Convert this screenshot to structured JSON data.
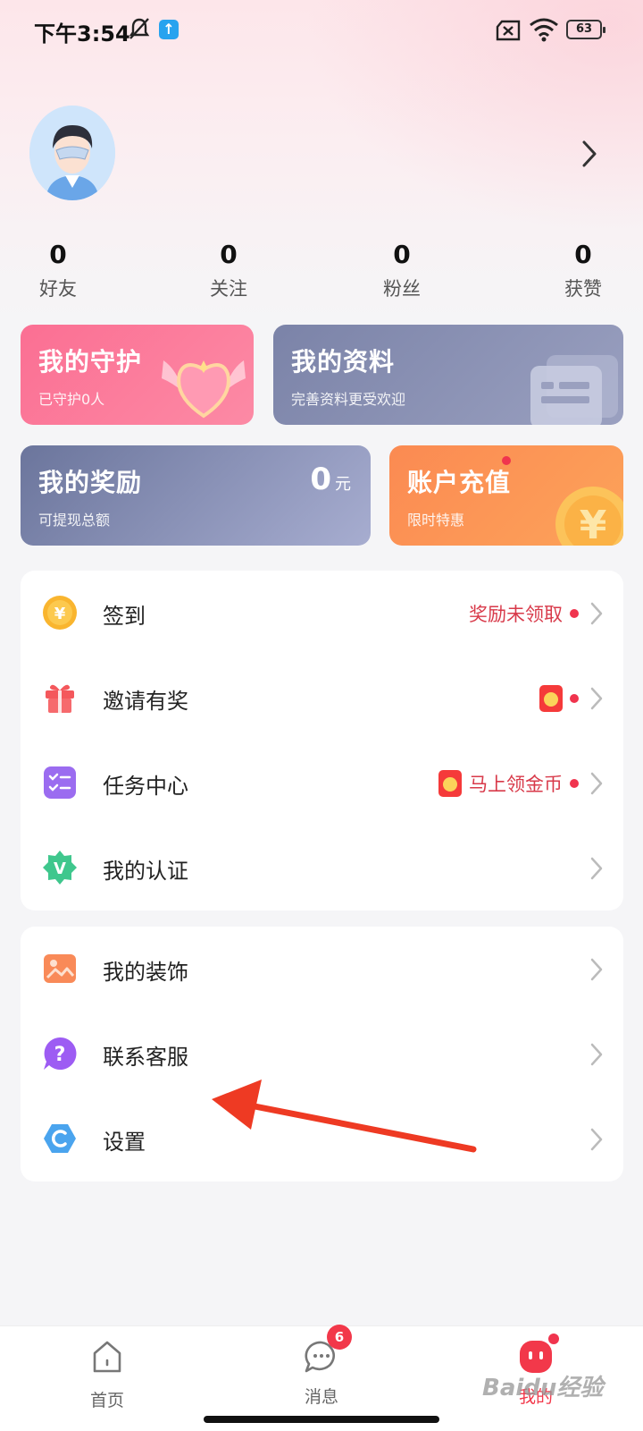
{
  "status_bar": {
    "time": "下午3:54",
    "battery": "63"
  },
  "stats": [
    {
      "value": "0",
      "label": "好友"
    },
    {
      "value": "0",
      "label": "关注"
    },
    {
      "value": "0",
      "label": "粉丝"
    },
    {
      "value": "0",
      "label": "获赞"
    }
  ],
  "cards": {
    "guard": {
      "title": "我的守护",
      "subtitle": "已守护0人"
    },
    "profile": {
      "title": "我的资料",
      "subtitle": "完善资料更受欢迎"
    },
    "reward": {
      "title": "我的奖励",
      "subtitle": "可提现总额",
      "amount": "0",
      "unit": "元"
    },
    "recharge": {
      "title": "账户充值",
      "subtitle": "限时特惠"
    }
  },
  "menu_group_1": [
    {
      "label": "签到",
      "right_text": "奖励未领取",
      "icon": "yen-coin-icon"
    },
    {
      "label": "邀请有奖",
      "right_text": "",
      "icon": "gift-icon"
    },
    {
      "label": "任务中心",
      "right_text": "马上领金币",
      "icon": "task-list-icon"
    },
    {
      "label": "我的认证",
      "right_text": "",
      "icon": "verified-badge-icon"
    }
  ],
  "menu_group_2": [
    {
      "label": "我的装饰",
      "icon": "picture-icon"
    },
    {
      "label": "联系客服",
      "icon": "help-question-icon"
    },
    {
      "label": "设置",
      "icon": "settings-hexagon-icon"
    }
  ],
  "bottom_nav": {
    "home": "首页",
    "messages": "消息",
    "messages_badge": "6",
    "mine": "我的"
  },
  "watermark": "Baidu经验",
  "colors": {
    "accent_red": "#f0344e",
    "guard_pink": "#fb6f93",
    "recharge_orange": "#fb8a52",
    "slate": "#7b83a8"
  }
}
